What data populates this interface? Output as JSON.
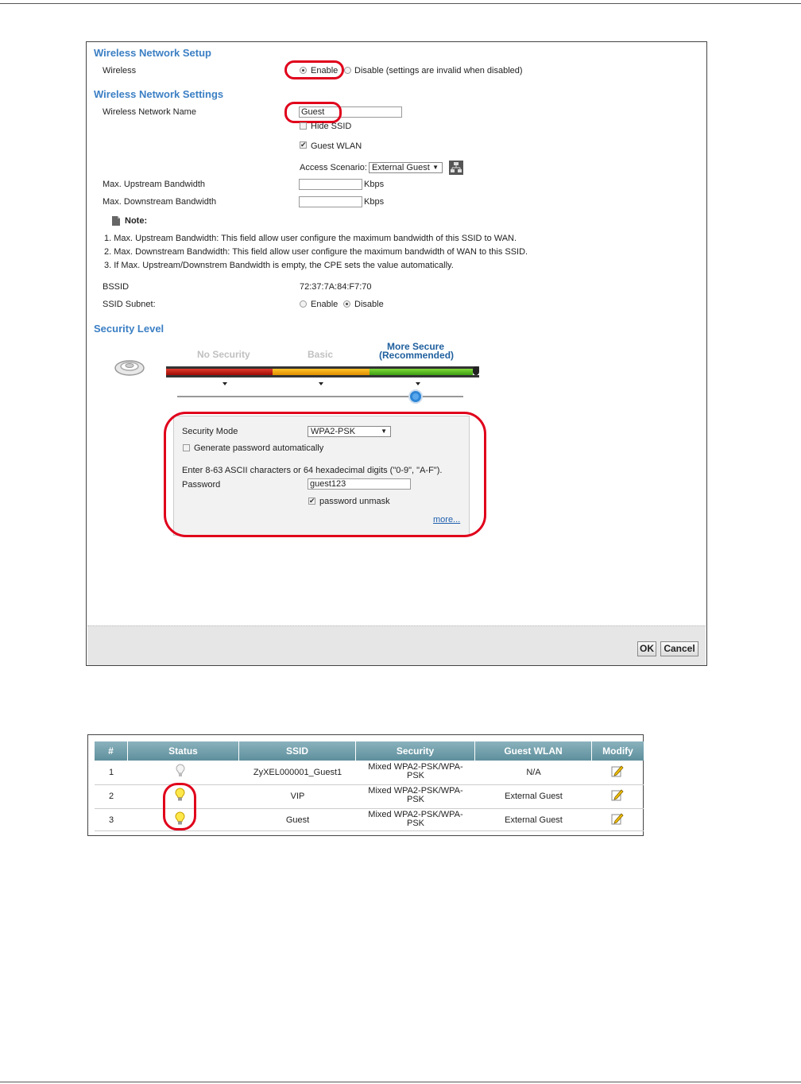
{
  "form": {
    "sections": {
      "network_setup": "Wireless Network Setup",
      "network_settings": "Wireless Network Settings",
      "security_level": "Security Level"
    },
    "wireless": {
      "label": "Wireless",
      "enable": "Enable",
      "disable": "Disable (settings are invalid when disabled)",
      "selected": "Enable"
    },
    "network_name": {
      "label": "Wireless Network Name",
      "value": "Guest"
    },
    "hide_ssid": {
      "label": "Hide SSID",
      "checked": false
    },
    "guest_wlan": {
      "label": "Guest WLAN",
      "checked": true
    },
    "access_scenario": {
      "label": "Access Scenario:",
      "value": "External Guest"
    },
    "upstream": {
      "label": "Max. Upstream Bandwidth",
      "value": "",
      "unit": "Kbps"
    },
    "downstream": {
      "label": "Max. Downstream Bandwidth",
      "value": "",
      "unit": "Kbps"
    },
    "note": {
      "title": "Note:",
      "items": [
        "1. Max. Upstream Bandwidth: This field allow user configure the maximum bandwidth of this SSID to WAN.",
        "2. Max. Downstream Bandwidth: This field allow user configure the maximum bandwidth of WAN to this SSID.",
        "3. If Max. Upstream/Downstrem Bandwidth is empty, the CPE sets the value automatically."
      ]
    },
    "bssid": {
      "label": "BSSID",
      "value": "72:37:7A:84:F7:70"
    },
    "ssid_subnet": {
      "label": "SSID Subnet:",
      "enable": "Enable",
      "disable": "Disable",
      "selected": "Disable"
    },
    "security": {
      "levels": [
        "No Security",
        "Basic",
        "More Secure",
        "(Recommended)"
      ],
      "selected_level": "More Secure",
      "colors": {
        "red": "#c8140f",
        "orange": "#f5a500",
        "green": "#5cbf21",
        "active": "#1f5f9e",
        "inactive": "#c0c0c0"
      },
      "mode_label": "Security Mode",
      "mode_value": "WPA2-PSK",
      "generate_label": "Generate password automatically",
      "generate_checked": false,
      "hint": "Enter 8-63 ASCII characters or 64 hexadecimal digits (\"0-9\", \"A-F\").",
      "password_label": "Password",
      "password_value": "guest123",
      "unmask_label": "password unmask",
      "unmask_checked": true,
      "more_link": "more..."
    },
    "buttons": {
      "ok": "OK",
      "cancel": "Cancel"
    }
  },
  "table": {
    "headers": [
      "#",
      "Status",
      "SSID",
      "Security",
      "Guest WLAN",
      "Modify"
    ],
    "rows": [
      {
        "num": "1",
        "status": "off",
        "ssid": "ZyXEL000001_Guest1",
        "security_1": "Mixed WPA2-PSK/WPA-",
        "security_2": "PSK",
        "guest": "N/A"
      },
      {
        "num": "2",
        "status": "on",
        "ssid": "VIP",
        "security_1": "Mixed WPA2-PSK/WPA-",
        "security_2": "PSK",
        "guest": "External Guest"
      },
      {
        "num": "3",
        "status": "on",
        "ssid": "Guest",
        "security_1": "Mixed WPA2-PSK/WPA-",
        "security_2": "PSK",
        "guest": "External Guest"
      }
    ]
  }
}
